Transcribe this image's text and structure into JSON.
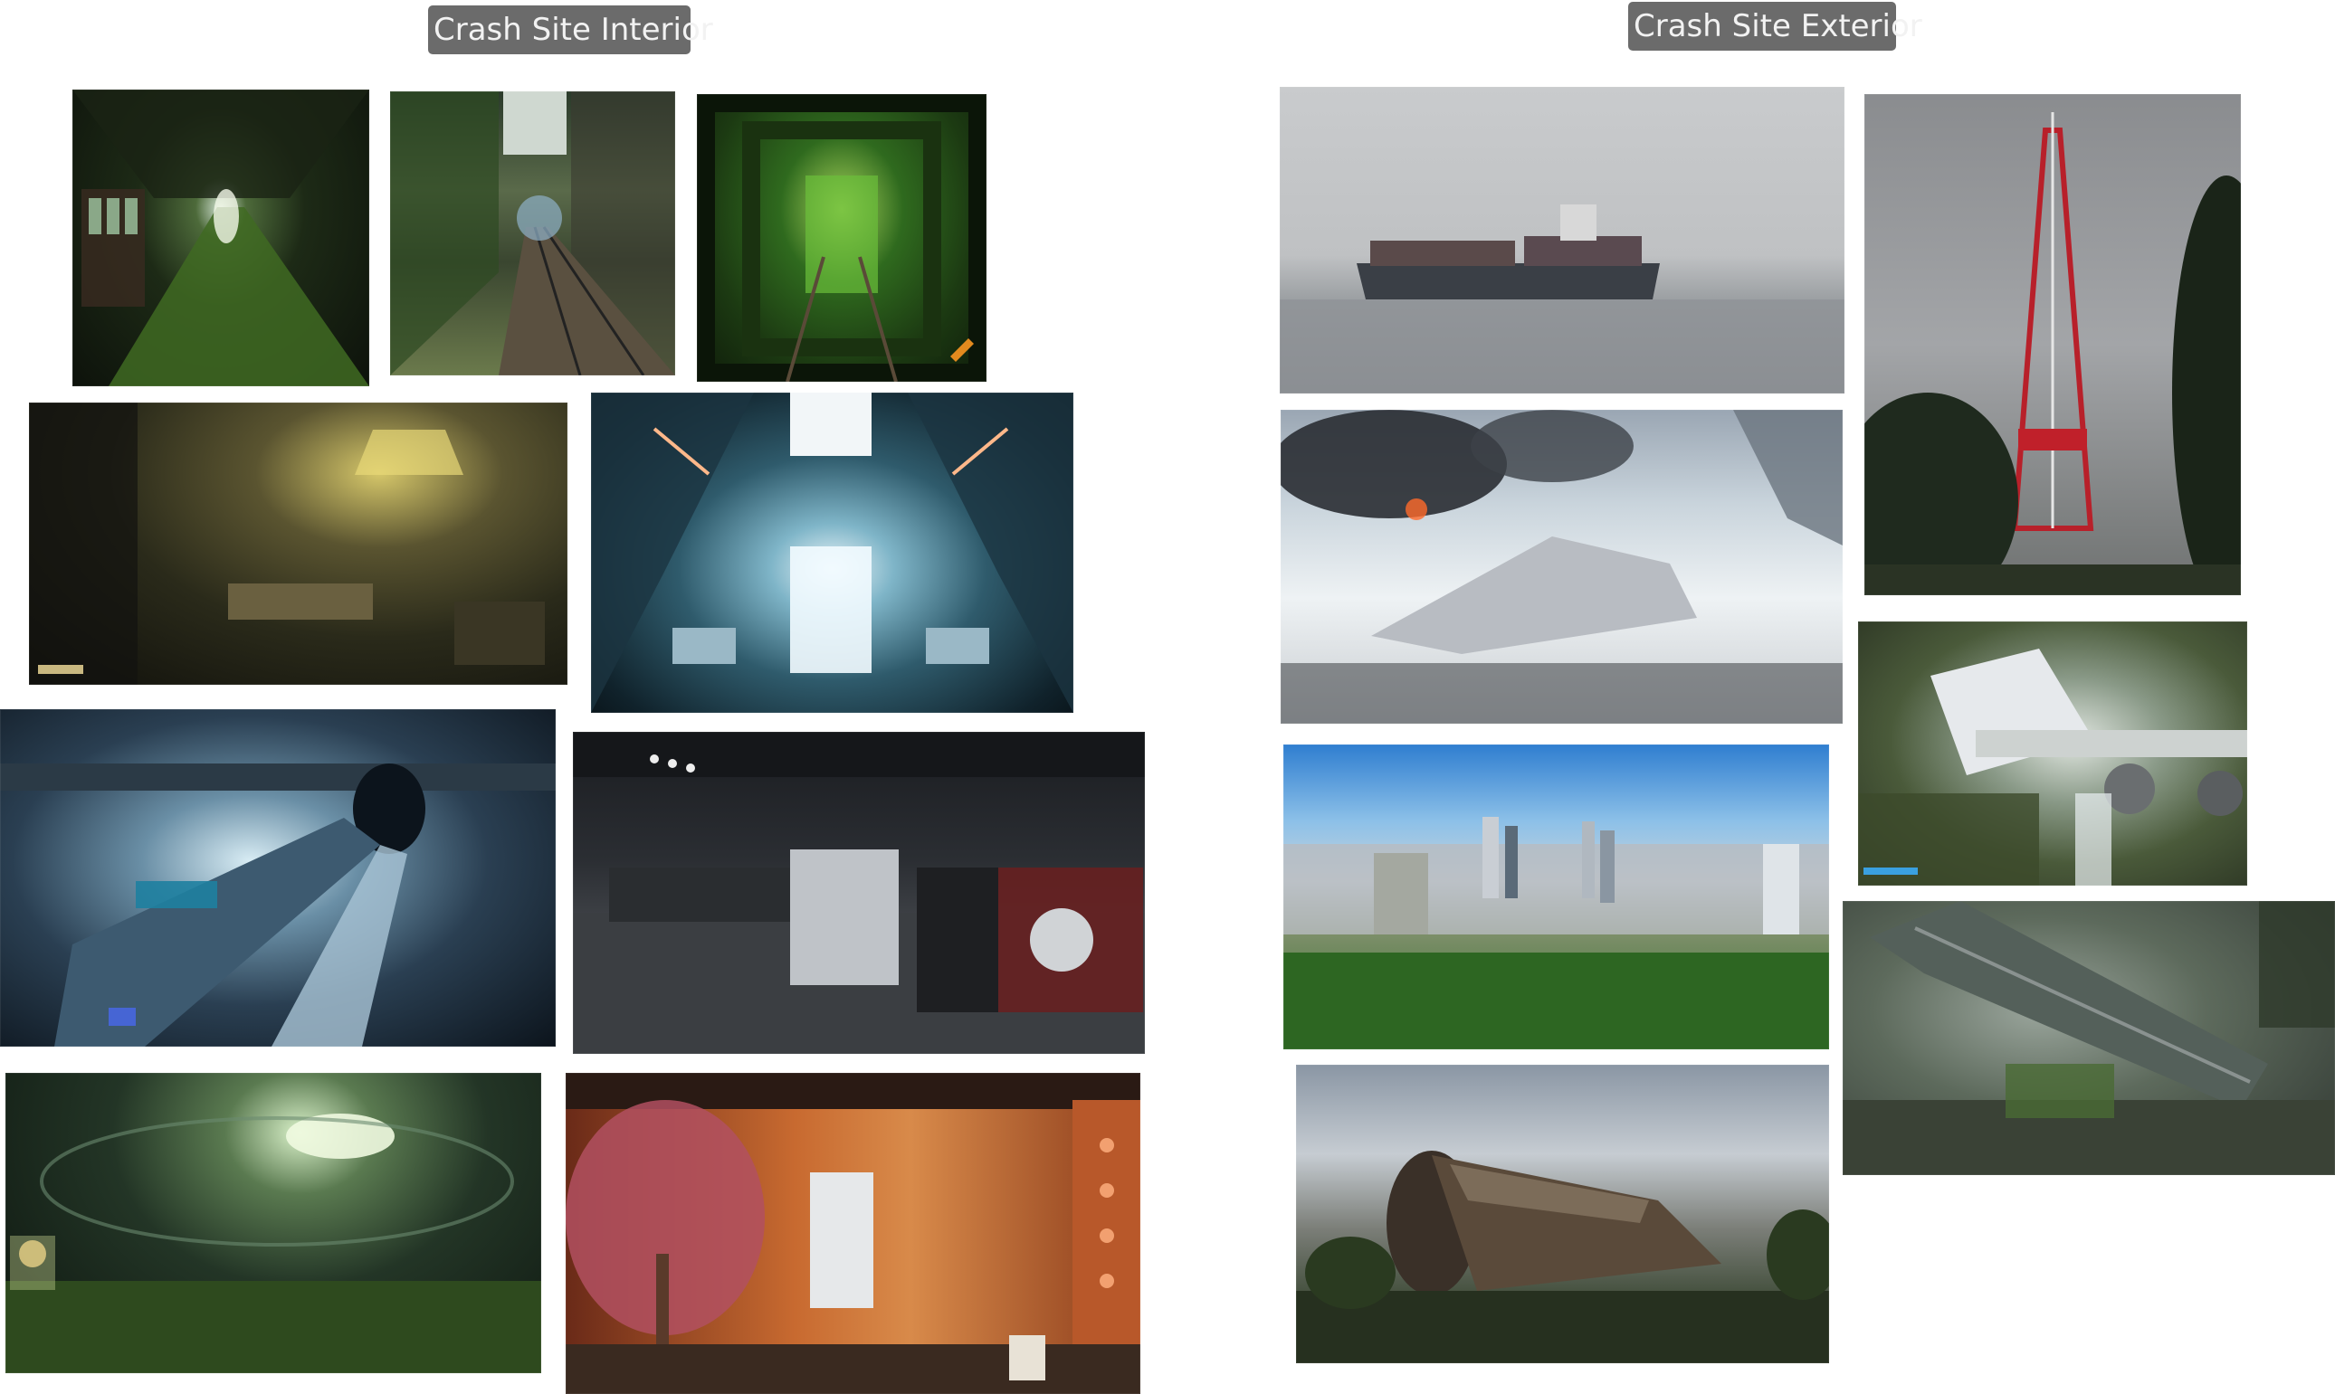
{
  "sections": {
    "interior": {
      "title": "Crash Site Interior",
      "images": [
        {
          "name": "overgrown-train-car-image"
        },
        {
          "name": "overgrown-tunnel-tracks-image"
        },
        {
          "name": "vine-covered-tunnel-image"
        },
        {
          "name": "dark-machinery-room-image"
        },
        {
          "name": "spaceship-corridor-image"
        },
        {
          "name": "tube-corridor-image"
        },
        {
          "name": "hangar-bay-image"
        },
        {
          "name": "overgrown-dome-hall-image"
        },
        {
          "name": "orange-ship-interior-tree-image"
        }
      ]
    },
    "exterior": {
      "title": "Crash Site Exterior",
      "images": [
        {
          "name": "container-ship-fog-image"
        },
        {
          "name": "radio-tower-image"
        },
        {
          "name": "snowy-crash-landing-image"
        },
        {
          "name": "plane-wreck-waterfall-image"
        },
        {
          "name": "city-skyline-image"
        },
        {
          "name": "overgrown-train-wreck-image"
        },
        {
          "name": "rusted-ship-wreck-image"
        }
      ]
    }
  },
  "colors": {
    "label_bg": "#6b6b6b",
    "label_text": "#f2f2f2",
    "canvas_bg": "#ffffff"
  }
}
